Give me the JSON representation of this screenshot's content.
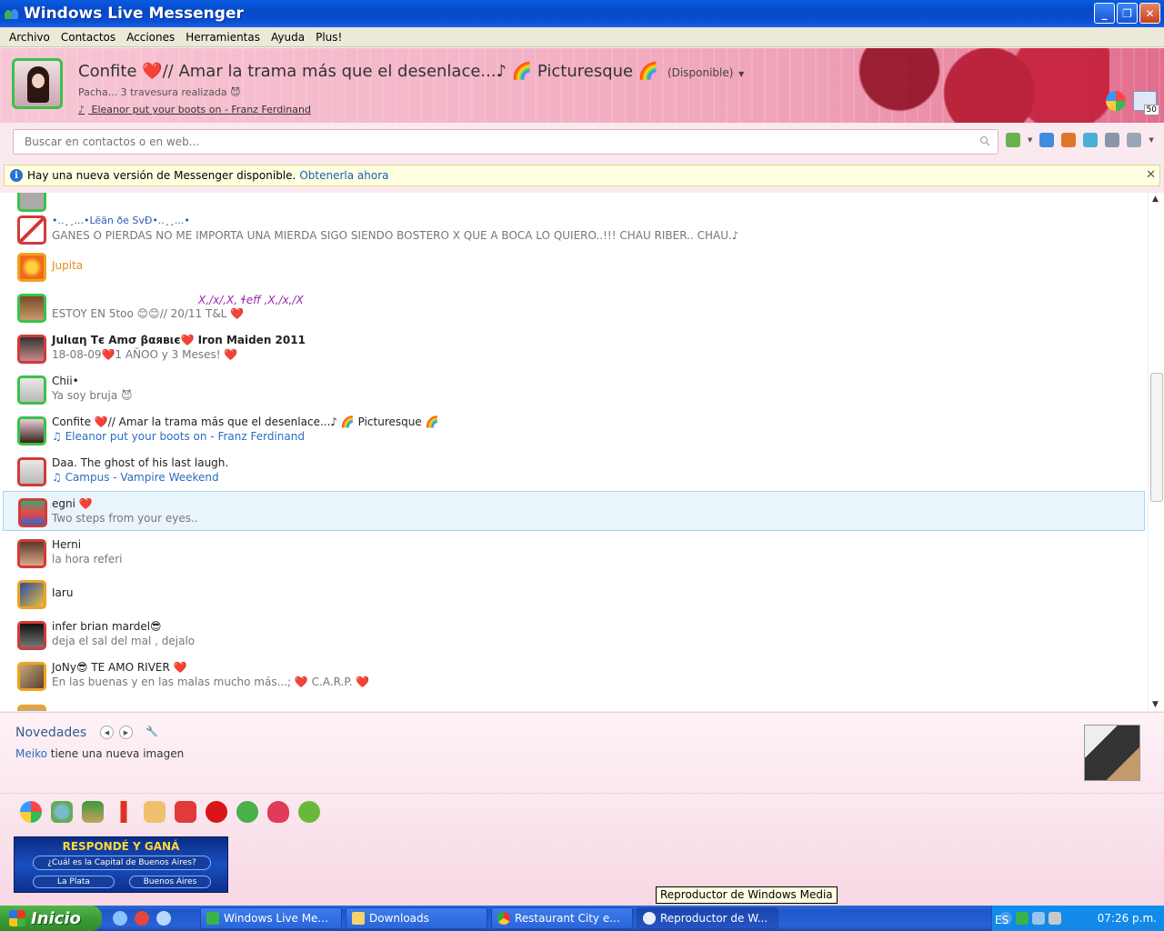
{
  "window": {
    "title": "Windows Live Messenger"
  },
  "menu": [
    "Archivo",
    "Contactos",
    "Acciones",
    "Herramientas",
    "Ayuda",
    "Plus!"
  ],
  "profile": {
    "nick": "Confite ❤️// Amar la trama más que el desenlace...♪ 🌈 Picturesque 🌈",
    "status": "(Disponible)",
    "psm": "Pacha... 3 travesura realizada 😈",
    "now_playing": "Eleanor put your boots on - Franz Ferdinand",
    "mail_count": "50"
  },
  "search": {
    "placeholder": "Buscar en contactos o en web..."
  },
  "update_bar": {
    "text": "Hay una nueva versión de Messenger disponible.",
    "link": "Obtenerla ahora"
  },
  "contacts": [
    {
      "name": "•..¸¸...•Lëän ðe SvÐ•..¸¸...•",
      "msg": "GANES O PIERDAS NO ME IMPORTA UNA MIERDA SIGO SIENDO BOSTERO X QUE A BOCA LO QUIERO..!!! CHAU RIBER.. CHAU.♪",
      "status": "busy"
    },
    {
      "name": "Jupita",
      "msg": "",
      "status": "away"
    },
    {
      "name": "X,/x/,X, ɬeff ,X,/x,/X",
      "msg": "ESTOY EN 5too 😊😊// 20/11 T&L ❤️",
      "status": "online"
    },
    {
      "name": "Julιαη     Tє Amσ βαявιє❤️  Iron Maiden 2011",
      "msg": "18-08-09❤️1 AÑOO y 3 Meses! ❤️",
      "status": "busy"
    },
    {
      "name": "Chii•",
      "msg": "Ya soy bruja 😈",
      "status": "online"
    },
    {
      "name": "Confite ❤️// Amar la trama más que el desenlace...♪ 🌈 Picturesque 🌈",
      "msg": "♫ Eleanor put your boots on - Franz Ferdinand",
      "status": "online"
    },
    {
      "name": "Daa.          The ghost of his last laugh.",
      "msg": "♫ Campus - Vampire Weekend",
      "status": "busy"
    },
    {
      "name": "egni ❤️",
      "msg": "Two steps from your eyes..",
      "status": "busy"
    },
    {
      "name": "Herni",
      "msg": "la hora referi",
      "status": "busy"
    },
    {
      "name": "Iaru",
      "msg": "",
      "status": "away"
    },
    {
      "name": "infer  brian                        mardel😎",
      "msg": "deja el sal del mal , dejalo",
      "status": "busy"
    },
    {
      "name": "JoNy😎              TE AMO RIVER ❤️",
      "msg": "En las buenas y en las malas mucho más...; ❤️ C.A.R.P. ❤️",
      "status": "away"
    }
  ],
  "novedades": {
    "title": "Novedades",
    "who": "Meiko",
    "text": " tiene una nueva imagen"
  },
  "ad": {
    "header": "RESPONDÉ Y GANÁ",
    "question": "¿Cuál es la Capital de Buenos Aires?",
    "answer1": "La Plata",
    "answer2": "Buenos Aires"
  },
  "tooltip": "Reproductor de Windows Media",
  "taskbar": {
    "start": "Inicio",
    "tasks": [
      "Windows Live Me...",
      "Downloads",
      "Restaurant City e...",
      "Reproductor de W..."
    ],
    "lang": "ES",
    "clock": "07:26 p.m."
  }
}
